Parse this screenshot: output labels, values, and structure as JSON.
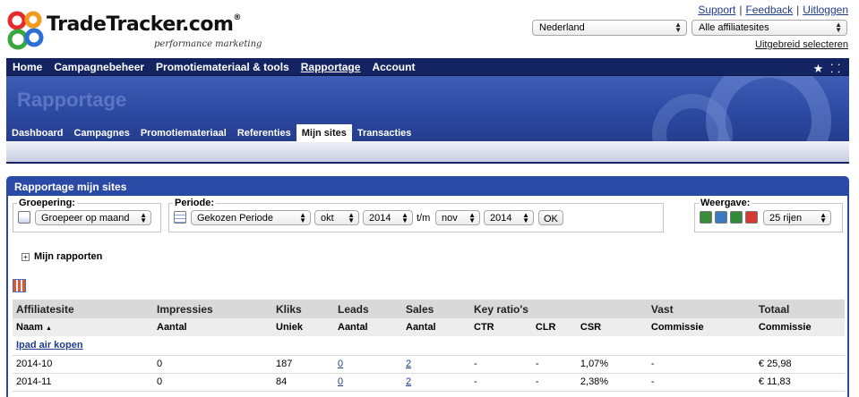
{
  "logo": {
    "brand": "TradeTracker.com",
    "tagline": "performance marketing",
    "rings": [
      "#e52b2b",
      "#f29a1f",
      "#3aa63f",
      "#2b6fd6"
    ]
  },
  "header": {
    "links": [
      "Support",
      "Feedback",
      "Uitloggen"
    ],
    "country": "Nederland",
    "affiliate_sites": "Alle affiliatesites",
    "advanced_select": "Uitgebreid selecteren"
  },
  "mainnav": {
    "items": [
      "Home",
      "Campagnebeheer",
      "Promotiemateriaal & tools",
      "Rapportage",
      "Account"
    ],
    "active": "Rapportage",
    "icons": [
      "star-icon",
      "sitemap-icon"
    ]
  },
  "banner": {
    "title": "Rapportage"
  },
  "subnav": {
    "items": [
      "Dashboard",
      "Campagnes",
      "Promotiemateriaal",
      "Referenties",
      "Mijn sites",
      "Transacties"
    ],
    "active": "Mijn sites"
  },
  "panel": {
    "title": "Rapportage mijn sites",
    "grouping": {
      "label": "Groepering:",
      "value": "Groepeer op maand"
    },
    "period": {
      "label": "Periode:",
      "preset": "Gekozen Periode",
      "from_month": "okt",
      "from_year": "2014",
      "range_sep": "t/m",
      "to_month": "nov",
      "to_year": "2014",
      "ok": "OK"
    },
    "view": {
      "label": "Weergave:",
      "rows": "25 rijen",
      "export_icons": [
        "export-icon",
        "email-icon",
        "excel-icon",
        "pdf-icon"
      ]
    },
    "my_reports": "Mijn rapporten"
  },
  "table": {
    "groups": [
      "Affiliatesite",
      "Impressies",
      "Kliks",
      "Leads",
      "Sales",
      "Key ratio's",
      "",
      "",
      "Vast",
      "Totaal"
    ],
    "subheaders": [
      "Naam",
      "Aantal",
      "Uniek",
      "Aantal",
      "Aantal",
      "CTR",
      "CLR",
      "CSR",
      "Commissie",
      "Commissie"
    ],
    "sort_indicator": "▲",
    "site": "Ipad air kopen",
    "rows": [
      [
        "2014-10",
        "0",
        "187",
        "0",
        "2",
        "-",
        "-",
        "1,07%",
        "-",
        "€ 25,98"
      ],
      [
        "2014-11",
        "0",
        "84",
        "0",
        "2",
        "-",
        "-",
        "2,38%",
        "-",
        "€ 11,83"
      ]
    ]
  }
}
